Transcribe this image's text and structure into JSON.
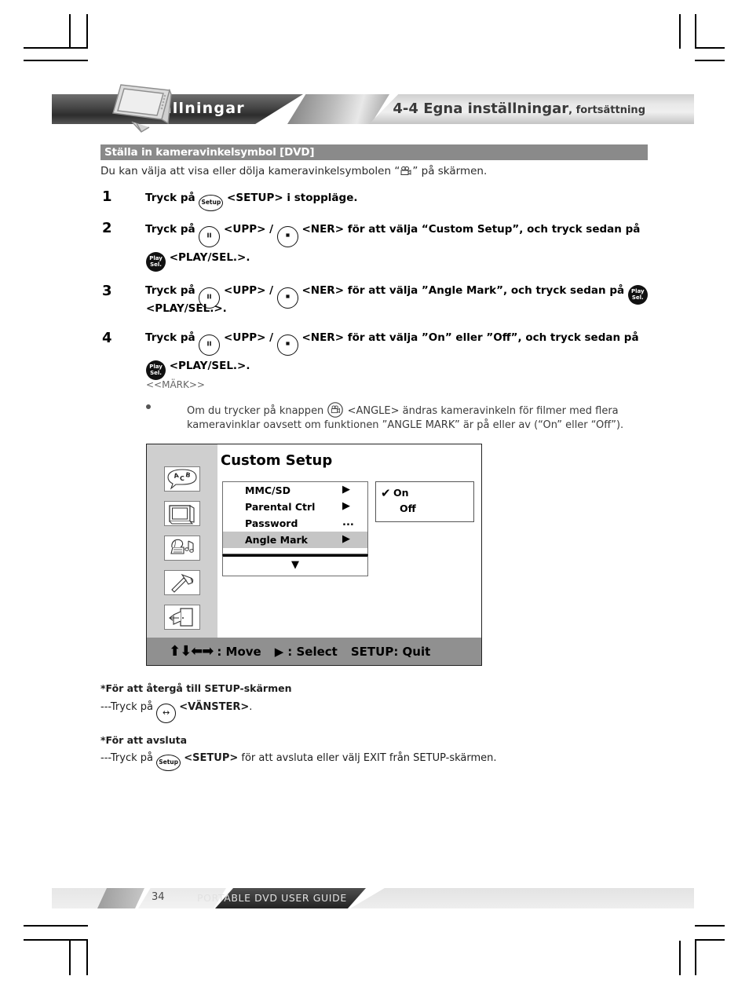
{
  "header": {
    "band_label": "Inställningar",
    "title_main": "4-4  Egna inställningar",
    "title_sub": ", fortsättning",
    "device_icon": "portable-dvd-player-illustration"
  },
  "section": {
    "bar_label": "Ställa in kameravinkelsymbol [DVD]",
    "intro_prefix": "Du kan välja att visa eller dölja kameravinkelsymbolen “",
    "intro_suffix": "” på skärmen.",
    "intro_icon": "camera-angle-icon"
  },
  "steps": [
    {
      "num": "1",
      "line1_a": "Tryck på",
      "btn1": "Setup",
      "line1_b": "<SETUP> i stoppläge."
    },
    {
      "num": "2",
      "line1_a": "Tryck på",
      "btn_up": "▮▮",
      "line1_b": "<UPP> /",
      "btn_down": "▪",
      "line1_c": "<NER> för att välja “Custom Setup”, och tryck sedan på",
      "line2_btn": {
        "top": "Play",
        "bottom": "Sel."
      },
      "line2_text": "<PLAY/SEL.>."
    },
    {
      "num": "3",
      "line1_a": "Tryck på",
      "btn_up": "▮▮",
      "line1_b": "<UPP> /",
      "btn_down": "▪",
      "line1_c": "<NER> för att välja ”Angle Mark”, och tryck sedan på",
      "line1_btn": {
        "top": "Play",
        "bottom": "Sel."
      },
      "line2_text": "<PLAY/SEL.>."
    },
    {
      "num": "4",
      "line1_a": "Tryck på",
      "btn_up": "▮▮",
      "line1_b": "<UPP> /",
      "btn_down": "▪",
      "line1_c": "<NER> för att välja ”On” eller ”Off”, och tryck sedan på",
      "line2_btn": {
        "top": "Play",
        "bottom": "Sel."
      },
      "line2_text": "<PLAY/SEL.>."
    }
  ],
  "mark_label": "<<MÄRK>>",
  "note": {
    "line1_a": "Om du trycker på knappen",
    "angle_button_icon": "camera-angle-icon",
    "line1_b": "<ANGLE> ändras kameravinkeln för filmer med flera",
    "line2": "kameravinklar oavsett om funktionen ”ANGLE MARK” är på eller av (“On” eller “Off”)."
  },
  "osd": {
    "title": "Custom Setup",
    "sidebar_icons": [
      "language-speech-bubble-icon",
      "tv-display-icon",
      "audio-gramophone-icon",
      "custom-hammer-icon",
      "exit-door-icon"
    ],
    "menu_items": [
      {
        "label": "MMC/SD",
        "value": "▶",
        "selected": false
      },
      {
        "label": "Parental Ctrl",
        "value": "▶",
        "selected": false
      },
      {
        "label": "Password",
        "value": "...",
        "selected": false
      },
      {
        "label": "Angle Mark",
        "value": "▶",
        "selected": true
      }
    ],
    "scroll_down": "▼",
    "options": [
      {
        "label": "On",
        "checked": true
      },
      {
        "label": "Off",
        "checked": false
      }
    ],
    "check_glyph": "✔",
    "footer": {
      "arrows": "⬆⬇⬅➡",
      "move_label": ": Move",
      "select_arrow": "▶",
      "select_label": ": Select",
      "quit_label": "SETUP: Quit"
    }
  },
  "return_note": {
    "heading": "*För att återgå till SETUP-skärmen",
    "prefix": "---Tryck på",
    "button_glyph": "↔",
    "bold": "<VÄNSTER>",
    "suffix": "."
  },
  "exit_note": {
    "heading": "*För att avsluta",
    "prefix": "---Tryck på",
    "button_glyph": "Setup",
    "bold": "<SETUP>",
    "suffix": "för att avsluta eller välj EXIT från SETUP-skärmen."
  },
  "footer": {
    "page_number": "34",
    "guide_title": "PORTABLE DVD USER GUIDE"
  },
  "colors": {
    "section_bar": "#8a8a8a",
    "osd_sidebar": "#cfcfcf",
    "osd_selected_row": "#c5c5c5",
    "osd_footer": "#909090"
  }
}
